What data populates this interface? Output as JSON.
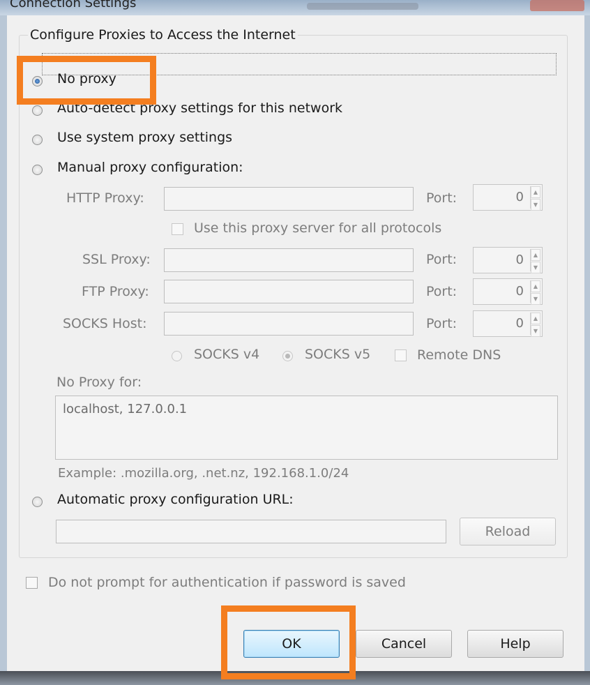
{
  "window": {
    "title": "Connection Settings"
  },
  "group": {
    "legend": "Configure Proxies to Access the Internet"
  },
  "radios": {
    "no_proxy": "No proxy",
    "auto_detect": "Auto-detect proxy settings for this network",
    "system": "Use system proxy settings",
    "manual": "Manual proxy configuration:",
    "auto_url": "Automatic proxy configuration URL:"
  },
  "manual": {
    "http_label": "HTTP Proxy:",
    "ssl_label": "SSL Proxy:",
    "ftp_label": "FTP Proxy:",
    "socks_label": "SOCKS Host:",
    "port_label": "Port:",
    "http_port": "0",
    "ssl_port": "0",
    "ftp_port": "0",
    "socks_port": "0",
    "share_label": "Use this proxy server for all protocols",
    "socks_v4": "SOCKS v4",
    "socks_v5": "SOCKS v5",
    "remote_dns": "Remote DNS"
  },
  "no_proxy_for": {
    "label": "No Proxy for:",
    "value": "localhost, 127.0.0.1",
    "example": "Example: .mozilla.org, .net.nz, 192.168.1.0/24"
  },
  "auto_config": {
    "reload_label": "Reload"
  },
  "auth": {
    "label": "Do not prompt for authentication if password is saved"
  },
  "buttons": {
    "ok": "OK",
    "cancel": "Cancel",
    "help": "Help"
  },
  "colors": {
    "highlight": "#f47e20",
    "selected_radio": "#1c4f92"
  }
}
